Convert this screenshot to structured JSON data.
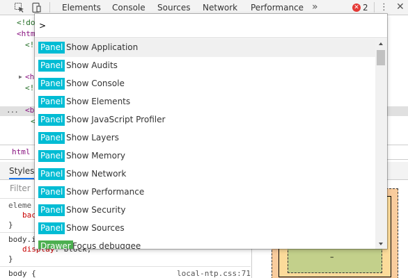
{
  "toolbar": {
    "tabs": [
      {
        "label": "Elements"
      },
      {
        "label": "Console"
      },
      {
        "label": "Sources"
      },
      {
        "label": "Network"
      },
      {
        "label": "Performance"
      }
    ],
    "more_tabs": "»",
    "error_count": "2",
    "error_icon_glyph": "✕",
    "menu_glyph": "⋮",
    "close_glyph": "✕",
    "icons": [
      "inspect-element-icon",
      "device-toolbar-icon",
      "more-tabs-icon",
      "error-icon",
      "more-options-icon",
      "close-icon"
    ]
  },
  "elements_panel": {
    "lines": [
      {
        "text": "<!do",
        "kind": "tag"
      },
      {
        "text": "<htm",
        "kind": "tag"
      },
      {
        "text": "<!",
        "kind": "comment"
      },
      {
        "text": "<he",
        "kind": "tag"
      },
      {
        "text": "<!",
        "kind": "comment"
      },
      {
        "text": "<bu",
        "kind": "tag"
      },
      {
        "text": "<",
        "kind": "comment"
      }
    ],
    "selected_dots": "...",
    "breadcrumb": "html"
  },
  "styles_panel": {
    "tab_label": "Styles",
    "filter_placeholder": "Filter",
    "rules": [
      {
        "selector": "eleme",
        "prop": "bac",
        "close": "}"
      },
      {
        "selector": "body.i",
        "prop": "display",
        "value": " block;",
        "close": "}"
      },
      {
        "selector": "body {",
        "source": "local-ntp.css:71"
      }
    ]
  },
  "box_model": {
    "content_dash": "–"
  },
  "command_menu": {
    "input_value": ">",
    "colors": {
      "panel_badge": "#00bcd4",
      "drawer_badge": "#4caf50",
      "selected_row": "#f0f0f0"
    },
    "items": [
      {
        "badge": "Panel",
        "label": "Show Application"
      },
      {
        "badge": "Panel",
        "label": "Show Audits"
      },
      {
        "badge": "Panel",
        "label": "Show Console"
      },
      {
        "badge": "Panel",
        "label": "Show Elements"
      },
      {
        "badge": "Panel",
        "label": "Show JavaScript Profiler"
      },
      {
        "badge": "Panel",
        "label": "Show Layers"
      },
      {
        "badge": "Panel",
        "label": "Show Memory"
      },
      {
        "badge": "Panel",
        "label": "Show Network"
      },
      {
        "badge": "Panel",
        "label": "Show Performance"
      },
      {
        "badge": "Panel",
        "label": "Show Security"
      },
      {
        "badge": "Panel",
        "label": "Show Sources"
      },
      {
        "badge": "Drawer",
        "label": "Focus debuggee"
      }
    ],
    "selected_index": 0
  }
}
